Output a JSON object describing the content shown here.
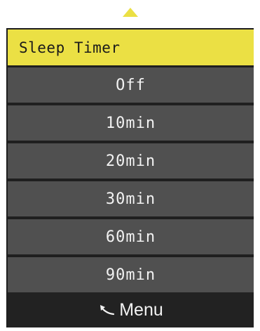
{
  "menu": {
    "title": "Sleep Timer",
    "options": [
      {
        "label": "Off"
      },
      {
        "label": "10min"
      },
      {
        "label": "20min"
      },
      {
        "label": "30min"
      },
      {
        "label": "60min"
      },
      {
        "label": "90min"
      }
    ],
    "footer_label": "Menu",
    "footer_icon": "back-arrow-icon",
    "scroll_indicator_icon": "up-arrow-icon"
  },
  "colors": {
    "accent": "#ebe044",
    "option_bg": "#505050",
    "footer_bg": "#222222",
    "text": "#f2f2f2"
  }
}
